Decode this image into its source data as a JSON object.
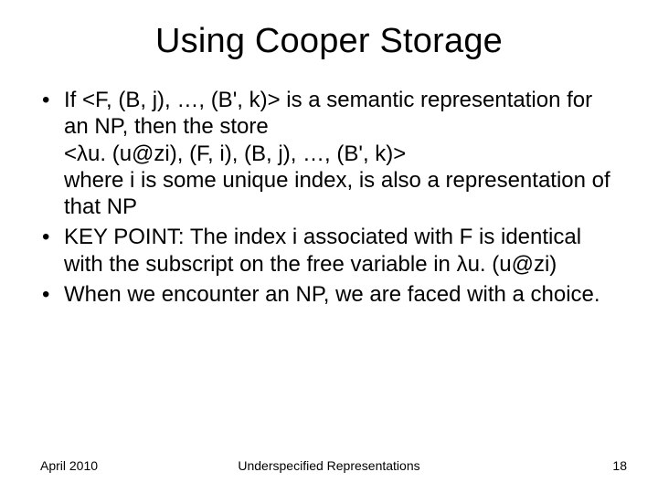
{
  "title": "Using Cooper Storage",
  "bullets": [
    "If <F, (B, j), …, (B', k)> is a semantic representation for an NP, then the store\n<λu. (u@zi), (F, i), (B, j), …, (B', k)>\nwhere i is some unique index, is also a representation of that NP",
    "KEY POINT: The index i associated with F is identical with the subscript on the free variable in λu. (u@zi)",
    "When we encounter an NP, we are faced with a choice."
  ],
  "footer": {
    "left": "April 2010",
    "center": "Underspecified Representations",
    "right": "18"
  }
}
